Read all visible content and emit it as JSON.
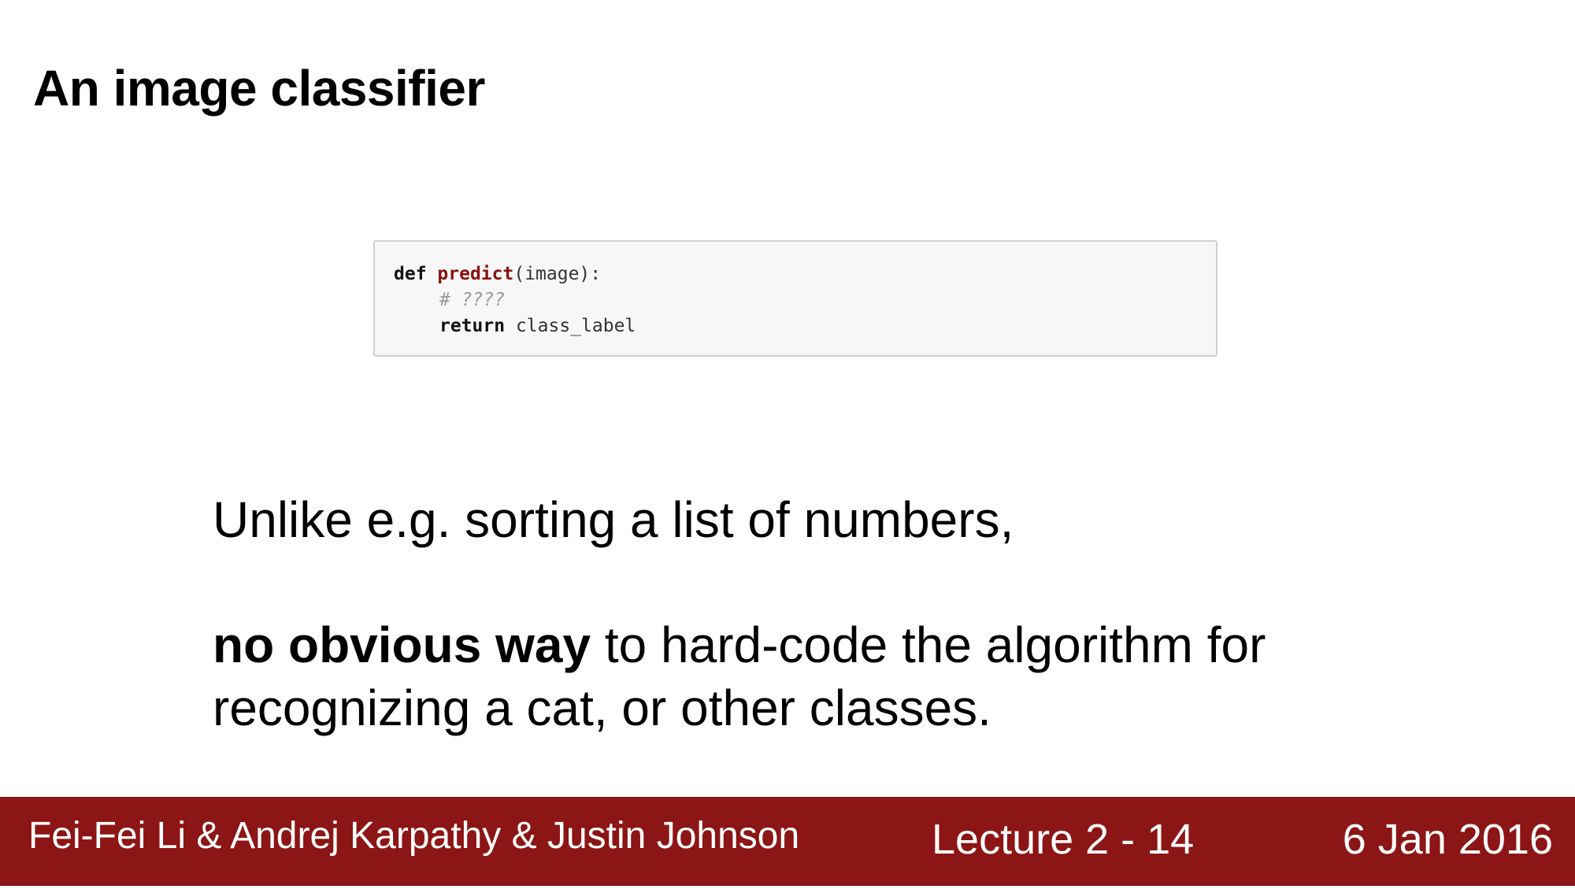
{
  "slide": {
    "title": "An image classifier"
  },
  "code": {
    "line1": {
      "keyword": "def",
      "function_name": "predict",
      "signature": "(image):"
    },
    "line2": {
      "comment": "# ????"
    },
    "line3": {
      "keyword": "return",
      "value": "class_label"
    }
  },
  "body": {
    "line1": "Unlike e.g. sorting a list of numbers,",
    "line2_bold": "no obvious way",
    "line2_rest": " to hard-code the algorithm for",
    "line3": "recognizing a cat, or other classes."
  },
  "footer": {
    "authors": "Fei-Fei Li & Andrej Karpathy & Justin Johnson",
    "lecture": "Lecture 2 - 14",
    "date": "6 Jan 2016",
    "background_color": "#8c1515"
  }
}
